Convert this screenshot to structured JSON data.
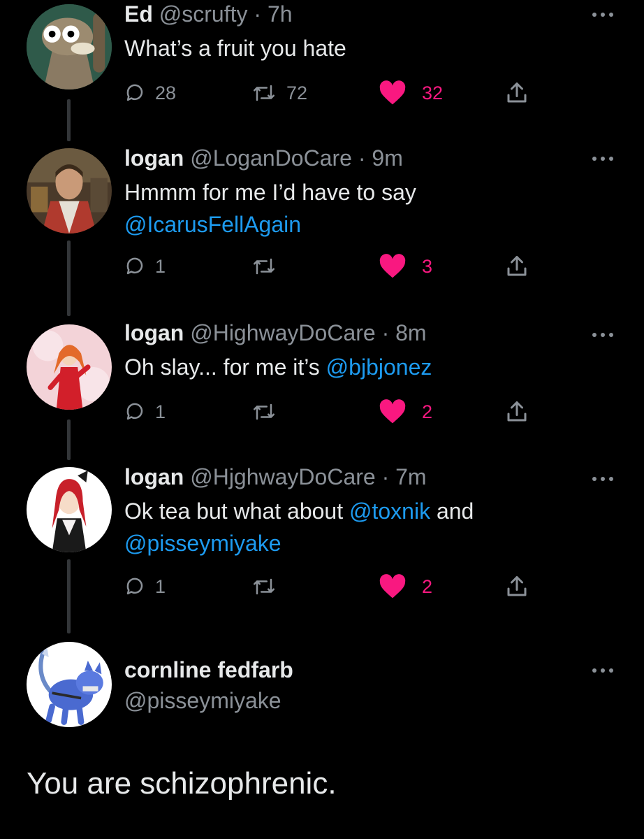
{
  "tweets": [
    {
      "name": "Ed",
      "handle": "@scrufty",
      "time": "7h",
      "text": [
        {
          "t": "What’s a fruit you hate",
          "m": false
        }
      ],
      "text2": [],
      "reply": "28",
      "retweet": "72",
      "like": "32",
      "avatar_icon": "raccoon-cartoon-avatar"
    },
    {
      "name": "logan",
      "handle": "@LoganDoCare",
      "time": "9m",
      "text": [
        {
          "t": "Hmmm for me I’d have to say",
          "m": false
        }
      ],
      "text2": [
        {
          "t": "@IcarusFellAgain",
          "m": true
        }
      ],
      "reply": "1",
      "retweet": "",
      "like": "3",
      "avatar_icon": "man-photo-avatar"
    },
    {
      "name": "logan",
      "handle": "@HighwayDoCare",
      "time": "8m",
      "text": [
        {
          "t": "Oh slay... for me it’s ",
          "m": false
        },
        {
          "t": "@bjbjonez",
          "m": true
        }
      ],
      "text2": [],
      "reply": "1",
      "retweet": "",
      "like": "2",
      "avatar_icon": "anime-girl-red-suit-avatar"
    },
    {
      "name": "logan",
      "handle": "@HjghwayDoCare",
      "time": "7m",
      "text": [
        {
          "t": "Ok tea but what about ",
          "m": false
        },
        {
          "t": "@toxnik",
          "m": true
        },
        {
          "t": " and",
          "m": false
        }
      ],
      "text2": [
        {
          "t": "@pisseymiyake",
          "m": true
        }
      ],
      "reply": "1",
      "retweet": "",
      "like": "2",
      "avatar_icon": "anime-girl-red-hair-avatar"
    }
  ],
  "main_tweet": {
    "name": "cornline fedfarb",
    "handle": "@pisseymiyake",
    "text": "You are schizophrenic.",
    "avatar_icon": "blue-wolf-creature-avatar"
  },
  "colors": {
    "background": "#000000",
    "text": "#e7e9ea",
    "muted": "#8b9198",
    "mention": "#1d9bf0",
    "like": "#f91880",
    "thread_line": "#333639"
  }
}
